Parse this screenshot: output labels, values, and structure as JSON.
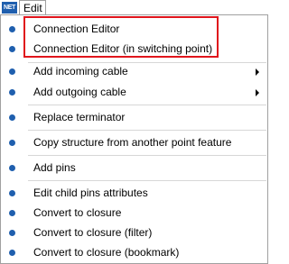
{
  "app_icon": {
    "text": "NET"
  },
  "menubar": {
    "edit_label": "Edit"
  },
  "menu": {
    "items": [
      {
        "label": "Connection Editor",
        "submenu": false
      },
      {
        "label": "Connection Editor (in switching point)",
        "submenu": false
      },
      {
        "label": "Add incoming cable",
        "submenu": true
      },
      {
        "label": "Add outgoing cable",
        "submenu": true
      },
      {
        "label": "Replace terminator",
        "submenu": false
      },
      {
        "label": "Copy structure from another point feature",
        "submenu": false
      },
      {
        "label": "Add pins",
        "submenu": false
      },
      {
        "label": "Edit child pins attributes",
        "submenu": false
      },
      {
        "label": "Convert to closure",
        "submenu": false
      },
      {
        "label": "Convert to closure (filter)",
        "submenu": false
      },
      {
        "label": "Convert to closure (bookmark)",
        "submenu": false
      }
    ]
  },
  "colors": {
    "bullet": "#1f5fae",
    "highlight_border": "#e0151c",
    "separator": "#d7d7d7"
  }
}
